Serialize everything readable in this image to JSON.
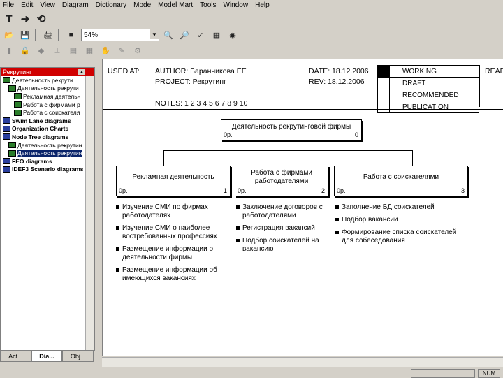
{
  "menu": [
    "File",
    "Edit",
    "View",
    "Diagram",
    "Dictionary",
    "Mode",
    "Model Mart",
    "Tools",
    "Window",
    "Help"
  ],
  "toolbar": {
    "zoom": "54%",
    "zoom_label": "54%"
  },
  "explorer": {
    "title": "Рекрутинг",
    "items": [
      {
        "label": "Деятельность рекрути",
        "level": 0,
        "bold": false,
        "selected": false
      },
      {
        "label": "Деятельность рекрути",
        "level": 1,
        "bold": false,
        "selected": false
      },
      {
        "label": "Рекламная деятельн",
        "level": 2,
        "bold": false,
        "selected": false
      },
      {
        "label": "Работа с фирмами р",
        "level": 2,
        "bold": false,
        "selected": false
      },
      {
        "label": "Работа с соискателя",
        "level": 2,
        "bold": false,
        "selected": false
      },
      {
        "label": "Swim Lane diagrams",
        "level": 0,
        "bold": true,
        "selected": false
      },
      {
        "label": "Organization Charts",
        "level": 0,
        "bold": true,
        "selected": false
      },
      {
        "label": "Node Tree diagrams",
        "level": 0,
        "bold": true,
        "selected": false
      },
      {
        "label": "Деятельность рекрутин",
        "level": 1,
        "bold": false,
        "selected": false
      },
      {
        "label": "Деятельность рекрутин",
        "level": 1,
        "bold": false,
        "selected": true
      },
      {
        "label": "FEO diagrams",
        "level": 0,
        "bold": true,
        "selected": false
      },
      {
        "label": "IDEF3 Scenario diagrams",
        "level": 0,
        "bold": true,
        "selected": false
      }
    ]
  },
  "tabs": [
    "Act...",
    "Dia...",
    "Obj..."
  ],
  "header": {
    "used_at": "USED AT:",
    "author": "AUTHOR: Баранникова ЕЕ",
    "project": "PROJECT: Рекрутинг",
    "date": "DATE: 18.12.2006",
    "rev": "REV: 18.12.2006",
    "notes": "NOTES: 1 2 3 4 5 6 7 8 9 10",
    "statuses": [
      "WORKING",
      "DRAFT",
      "RECOMMENDED",
      "PUBLICATION"
    ],
    "reader": "READ"
  },
  "diagram": {
    "root": {
      "title": "Деятельность рекрутинговой фирмы",
      "code": "0р.",
      "num": "0"
    },
    "children": [
      {
        "title": "Рекламная деятельность",
        "code": "0р.",
        "num": "1"
      },
      {
        "title": "Работа с фирмами работодателями",
        "code": "0р.",
        "num": "2"
      },
      {
        "title": "Работа с соискателями",
        "code": "0р.",
        "num": "3"
      }
    ],
    "bullets": [
      [
        "Изучение СМИ по фирмах работодателях",
        "Изучение СМИ о наиболее востребованных профессиях",
        "Размещение информации о деятельности фирмы",
        "Размещение информации об имеющихся вакансиях"
      ],
      [
        "Заключение договоров с работодателями",
        "Регистрация вакансий",
        "Подбор соискателей на вакансию"
      ],
      [
        "Заполнение БД соискателей",
        "Подбор вакансии",
        "Формирование списка соискателей для собеседования"
      ]
    ]
  },
  "status_bar": {
    "num": "NUM"
  }
}
